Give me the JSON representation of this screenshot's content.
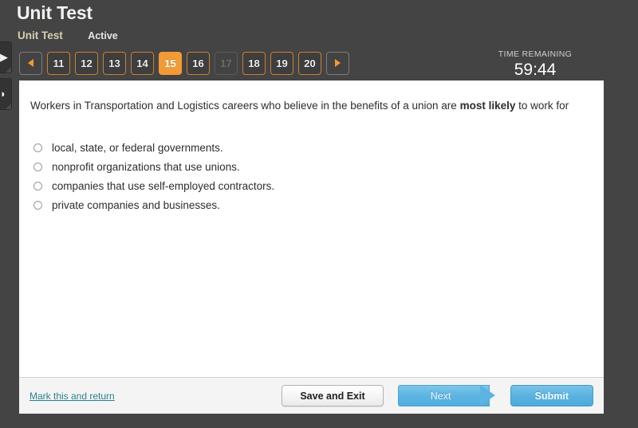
{
  "header": {
    "title": "Unit Test",
    "breadcrumb_link": "Unit Test",
    "status": "Active"
  },
  "timer": {
    "label": "TIME REMAINING",
    "value": "59:44"
  },
  "pager": {
    "prev_icon": "triangle-left-icon",
    "next_icon": "triangle-right-icon",
    "current": "15",
    "items": [
      {
        "label": "11",
        "state": "normal"
      },
      {
        "label": "12",
        "state": "normal"
      },
      {
        "label": "13",
        "state": "normal"
      },
      {
        "label": "14",
        "state": "normal"
      },
      {
        "label": "15",
        "state": "current"
      },
      {
        "label": "16",
        "state": "normal"
      },
      {
        "label": "17",
        "state": "disabled"
      },
      {
        "label": "18",
        "state": "normal"
      },
      {
        "label": "19",
        "state": "normal"
      },
      {
        "label": "20",
        "state": "normal"
      }
    ]
  },
  "edge_tabs": [
    {
      "icon": "chevron-right-icon",
      "glyph": "▶"
    },
    {
      "icon": "bookmark-icon",
      "glyph": "◗"
    }
  ],
  "question": {
    "text_before": "Workers in Transportation and Logistics careers who believe in the benefits of a union are ",
    "emphasis": "most likely",
    "text_after": " to work for",
    "choices": [
      {
        "label": "local, state, or federal governments.",
        "selected": false
      },
      {
        "label": "nonprofit organizations that use unions.",
        "selected": false
      },
      {
        "label": "companies that use self-employed contractors.",
        "selected": false
      },
      {
        "label": "private companies and businesses.",
        "selected": false
      }
    ]
  },
  "footer": {
    "mark_link": "Mark this and return",
    "save_label": "Save and Exit",
    "next_label": "Next",
    "submit_label": "Submit"
  },
  "colors": {
    "chrome": "#444444",
    "accent_orange": "#f29a34",
    "accent_blue": "#58b2e1",
    "link_teal": "#2a7f93",
    "breadcrumb_tan": "#d9cfae"
  }
}
